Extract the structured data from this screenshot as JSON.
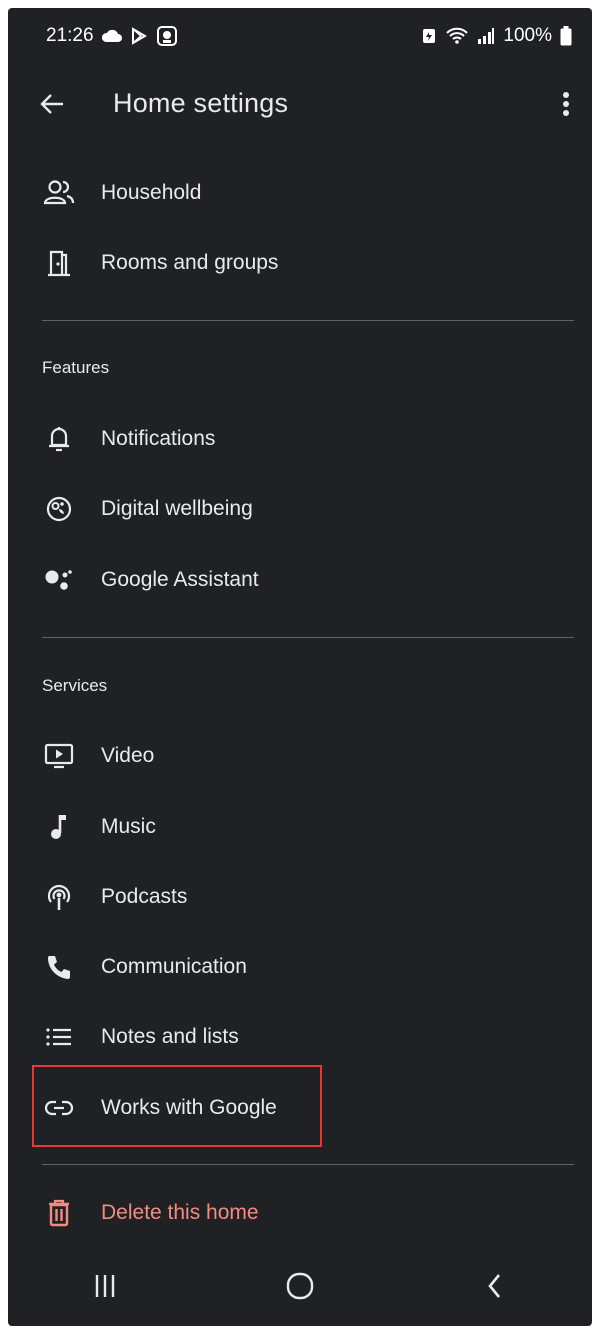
{
  "status_bar": {
    "time": "21:26",
    "battery_text": "100%"
  },
  "app_bar": {
    "title": "Home settings"
  },
  "top_items": [
    {
      "label": "Household",
      "icon": "people-icon"
    },
    {
      "label": "Rooms and groups",
      "icon": "door-icon"
    }
  ],
  "features": {
    "header": "Features",
    "items": [
      {
        "label": "Notifications",
        "icon": "bell-icon"
      },
      {
        "label": "Digital wellbeing",
        "icon": "wellbeing-icon"
      },
      {
        "label": "Google Assistant",
        "icon": "assistant-icon"
      }
    ]
  },
  "services": {
    "header": "Services",
    "items": [
      {
        "label": "Video",
        "icon": "video-icon"
      },
      {
        "label": "Music",
        "icon": "music-note-icon"
      },
      {
        "label": "Podcasts",
        "icon": "podcast-icon"
      },
      {
        "label": "Communication",
        "icon": "phone-icon"
      },
      {
        "label": "Notes and lists",
        "icon": "list-icon"
      },
      {
        "label": "Works with Google",
        "icon": "link-icon"
      }
    ]
  },
  "danger": {
    "delete_label": "Delete this home",
    "icon": "trash-icon",
    "color": "#f28b82"
  },
  "colors": {
    "background": "#202124",
    "text": "#e8eaed",
    "divider": "#5f6368",
    "highlight": "#e53935"
  }
}
